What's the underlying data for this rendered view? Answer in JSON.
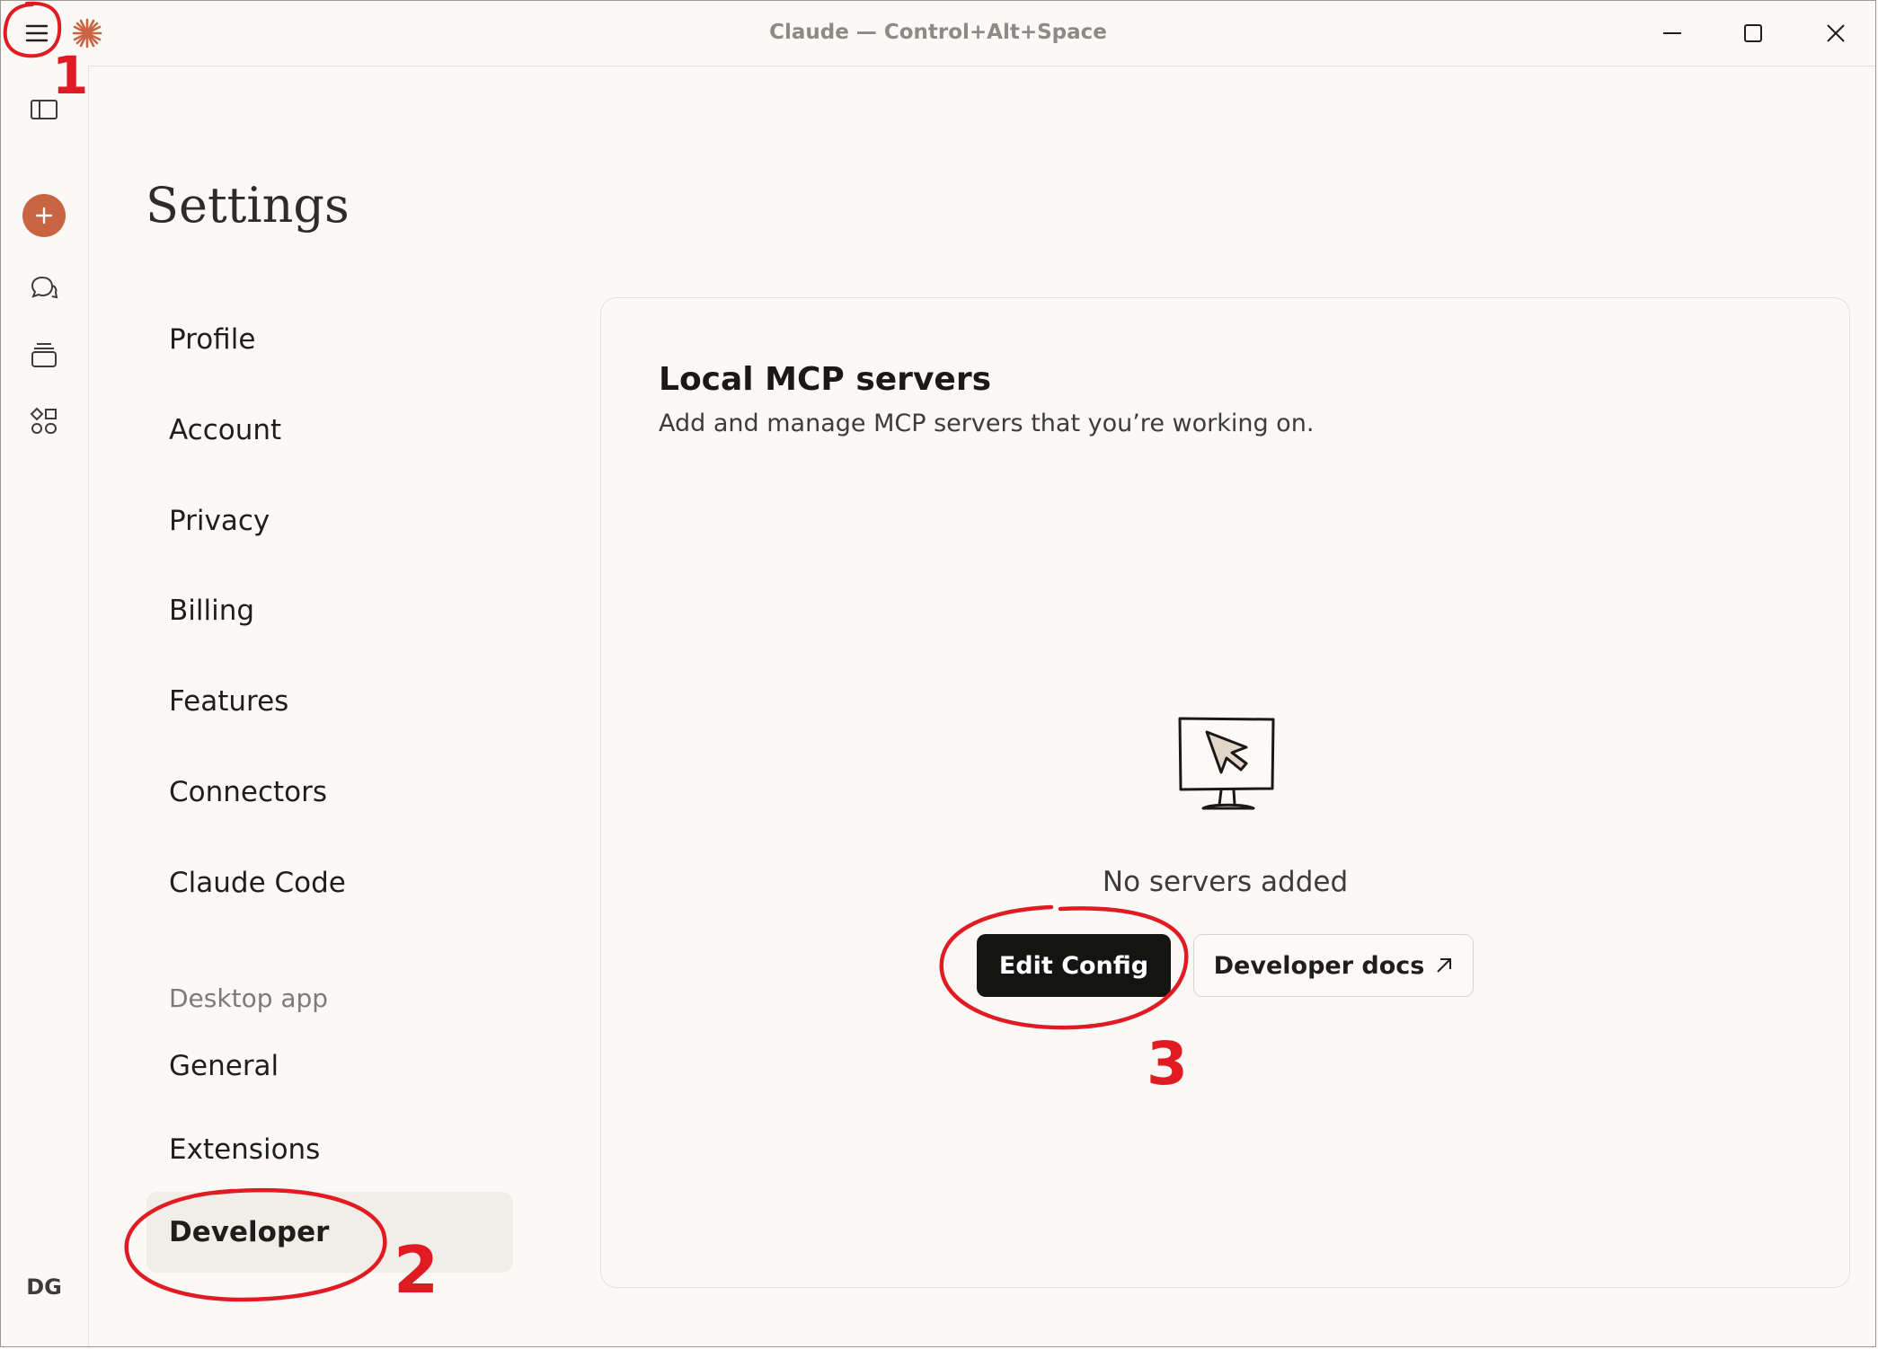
{
  "window": {
    "title": "Claude — Control+Alt+Space"
  },
  "page": {
    "title": "Settings"
  },
  "nav": {
    "items": [
      {
        "label": "Profile"
      },
      {
        "label": "Account"
      },
      {
        "label": "Privacy"
      },
      {
        "label": "Billing"
      },
      {
        "label": "Features"
      },
      {
        "label": "Connectors"
      },
      {
        "label": "Claude Code"
      }
    ],
    "section_label": "Desktop app",
    "desktop_items": [
      {
        "label": "General"
      },
      {
        "label": "Extensions"
      },
      {
        "label": "Developer",
        "active": true
      }
    ]
  },
  "rail": {
    "avatar_initials": "DG",
    "icons": [
      "sidebar-toggle-icon",
      "plus-icon",
      "chats-icon",
      "projects-icon",
      "artifacts-icon"
    ]
  },
  "card": {
    "title": "Local MCP servers",
    "subtitle": "Add and manage MCP servers that you’re working on.",
    "empty_text": "No servers added",
    "primary_button": "Edit Config",
    "secondary_button": "Developer docs"
  },
  "annotations": {
    "labels": [
      "1",
      "2",
      "3"
    ],
    "color": "#e01b24"
  },
  "colors": {
    "accent": "#c96442",
    "primary_button_bg": "#141413",
    "background": "#faf9f5"
  }
}
